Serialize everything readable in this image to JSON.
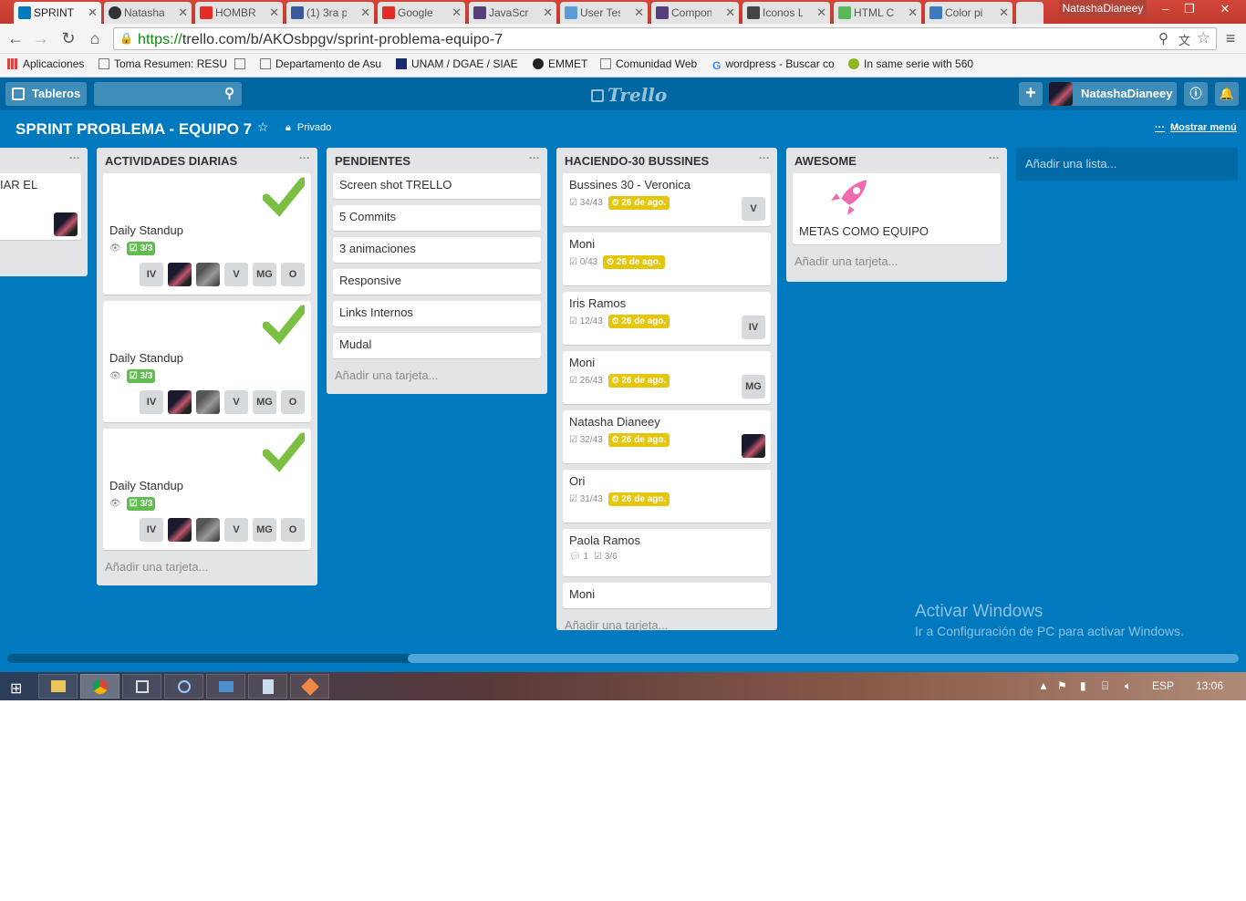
{
  "browser": {
    "tabs": [
      {
        "label": "SPRINT P",
        "color": "#0079bf",
        "active": true
      },
      {
        "label": "Natasha",
        "color": "#333333"
      },
      {
        "label": "HOMBRE",
        "color": "#e52d27"
      },
      {
        "label": "(1) 3ra p",
        "color": "#3b5998"
      },
      {
        "label": "Google",
        "color": "#e52d27"
      },
      {
        "label": "JavaScri",
        "color": "#563d7c"
      },
      {
        "label": "User Tes",
        "color": "#5b9bd5"
      },
      {
        "label": "Compon",
        "color": "#563d7c"
      },
      {
        "label": "Iconos L",
        "color": "#444444"
      },
      {
        "label": "HTML C",
        "color": "#5cb85c"
      },
      {
        "label": "Color pi",
        "color": "#3a7bbf"
      }
    ],
    "profile": "NatashaDianeey",
    "url_scheme": "https://",
    "url_rest": "trello.com/b/AKOsbpgv/sprint-problema-equipo-7",
    "bookmarks": [
      "Aplicaciones",
      "Toma Resumen: RESU",
      "Departamento de Asu",
      "UNAM / DGAE / SIAE",
      "EMMET",
      "Comunidad Web",
      "wordpress - Buscar co",
      "In same serie with 560"
    ]
  },
  "header": {
    "boards_label": "Tableros",
    "logo": "Trello",
    "user": "NatashaDianeey"
  },
  "board": {
    "title": "SPRINT PROBLEMA - EQUIPO 7",
    "privacy": "Privado",
    "menu": "Mostrar menú"
  },
  "lists": {
    "partial": {
      "card_text": "IAR EL"
    },
    "diarias": {
      "title": "ACTIVIDADES DIARIAS",
      "cards": [
        {
          "title": "Daily Standup",
          "checklist": "3/3",
          "members": [
            "IV",
            "",
            "",
            "V",
            "MG",
            "O"
          ]
        },
        {
          "title": "Daily Standup",
          "checklist": "3/3",
          "members": [
            "IV",
            "",
            "",
            "V",
            "MG",
            "O"
          ]
        },
        {
          "title": "Daily Standup",
          "checklist": "3/3",
          "members": [
            "IV",
            "",
            "",
            "V",
            "MG",
            "O"
          ]
        }
      ],
      "add": "Añadir una tarjeta..."
    },
    "pendientes": {
      "title": "PENDIENTES",
      "cards": [
        "Screen shot TRELLO",
        "5 Commits",
        "3 animaciones",
        "Responsive",
        "Links Internos",
        "Mudal"
      ],
      "add": "Añadir una tarjeta..."
    },
    "haciendo": {
      "title": "HACIENDO-30 BUSSINES",
      "cards": [
        {
          "title": "Bussines 30 - Veronica",
          "checklist": "34/43",
          "due": "26 de ago.",
          "member": "V"
        },
        {
          "title": "Moni",
          "checklist": "0/43",
          "due": "26 de ago.",
          "member": ""
        },
        {
          "title": "Iris Ramos",
          "checklist": "12/43",
          "due": "26 de ago.",
          "member": "IV"
        },
        {
          "title": "Moni",
          "checklist": "26/43",
          "due": "26 de ago.",
          "member": "MG"
        },
        {
          "title": "Natasha Dianeey",
          "checklist": "32/43",
          "due": "26 de ago.",
          "member": ""
        },
        {
          "title": "Ori",
          "checklist": "31/43",
          "due": "26 de ago.",
          "member": ""
        },
        {
          "title": "Paola Ramos",
          "comments": "1",
          "checklist": "3/6"
        },
        {
          "title": "Moni"
        }
      ],
      "add": "Añadir una tarjeta..."
    },
    "awesome": {
      "title": "AWESOME",
      "card": "METAS COMO EQUIPO",
      "add": "Añadir una tarjeta..."
    },
    "add_list": "Añadir una lista..."
  },
  "watermark": {
    "line1": "Activar Windows",
    "line2": "Ir a Configuración de PC para activar Windows."
  },
  "taskbar": {
    "lang": "ESP",
    "time": "13:06"
  }
}
